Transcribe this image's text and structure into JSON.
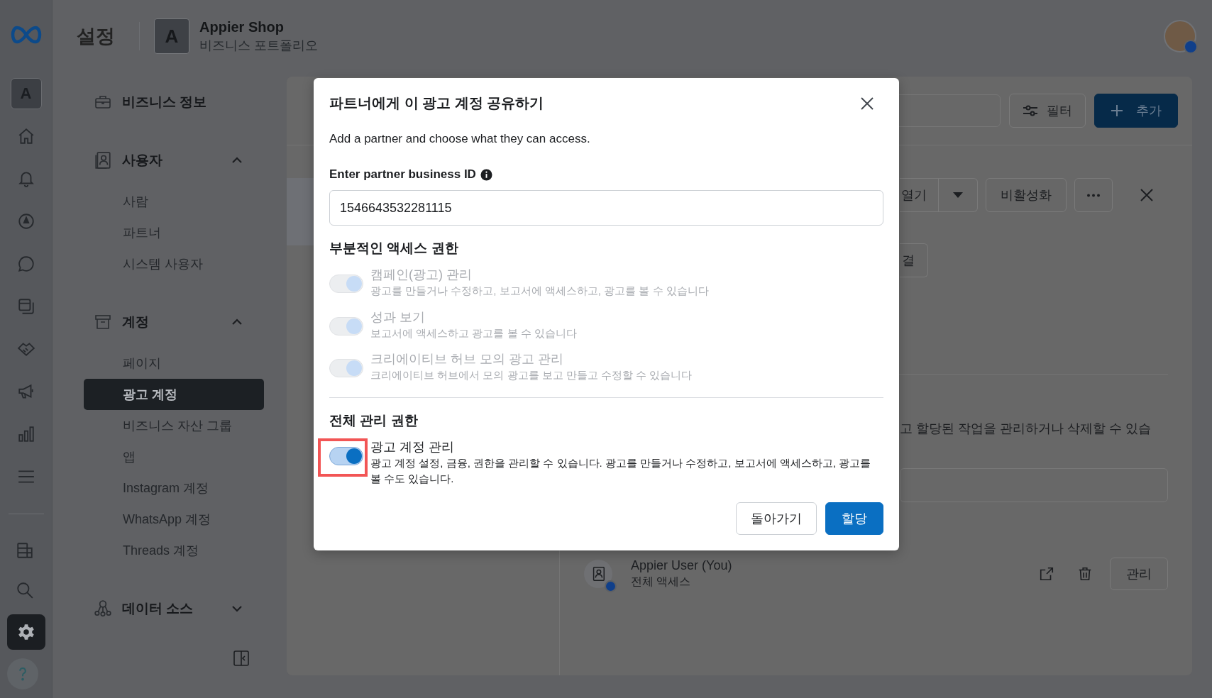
{
  "rail": {
    "avatar": "A",
    "top_items": [
      {
        "selected": false
      },
      {
        "selected": false
      },
      {
        "selected": false
      },
      {
        "selected": false
      },
      {
        "selected": false
      },
      {
        "selected": false
      },
      {
        "selected": false
      },
      {
        "selected": false
      },
      {
        "selected": false
      }
    ],
    "bottom_items": [
      {
        "selected": false
      },
      {
        "selected": false
      },
      {
        "selected": true
      },
      {
        "selected": false
      }
    ]
  },
  "header": {
    "title": "설정",
    "business": {
      "initial": "A",
      "name": "Appier Shop",
      "subtitle": "비즈니스 포트폴리오"
    }
  },
  "sidebar": {
    "groups": [
      {
        "kind": "link",
        "label": "비즈니스 정보"
      },
      {
        "kind": "section",
        "label": "사용자",
        "expanded": true,
        "children": [
          {
            "label": "사람",
            "selected": false
          },
          {
            "label": "파트너",
            "selected": false
          },
          {
            "label": "시스템 사용자",
            "selected": false
          }
        ]
      },
      {
        "kind": "section",
        "label": "계정",
        "expanded": true,
        "children": [
          {
            "label": "페이지",
            "selected": false
          },
          {
            "label": "광고 계정",
            "selected": true
          },
          {
            "label": "비즈니스 자산 그룹",
            "selected": false
          },
          {
            "label": "앱",
            "selected": false
          },
          {
            "label": "Instagram 계정",
            "selected": false
          },
          {
            "label": "WhatsApp 계정",
            "selected": false
          },
          {
            "label": "Threads 계정",
            "selected": false
          }
        ]
      },
      {
        "kind": "section",
        "label": "데이터 소스",
        "expanded": false
      }
    ]
  },
  "main": {
    "filter": "필터",
    "add": "추가"
  },
  "detail": {
    "open": "열기",
    "deactivate": "비활성화",
    "connect": "결",
    "note": "고 할당된 작업을 관리하거나 삭제할 수 있습",
    "user": {
      "name": "Appier User (You)",
      "access": "전체 액세스",
      "manage": "관리"
    }
  },
  "dialog": {
    "title": "파트너에게 이 광고 계정 공유하기",
    "subtitle": "Add a partner and choose what they can access.",
    "id_label": "Enter partner business ID",
    "id_value": "1546643532281115",
    "sections": [
      {
        "heading": "부분적인 액세스 권한",
        "permissions": [
          {
            "label": "캠페인(광고) 관리",
            "description": "광고를 만들거나 수정하고, 보고서에 액세스하고, 광고를 볼 수 있습니다",
            "on": true,
            "disabled": true,
            "highlighted": false
          },
          {
            "label": "성과 보기",
            "description": "보고서에 액세스하고 광고를 볼 수 있습니다",
            "on": true,
            "disabled": true,
            "highlighted": false
          },
          {
            "label": "크리에이티브 허브 모의 광고 관리",
            "description": "크리에이티브 허브에서 모의 광고를 보고 만들고 수정할 수 있습니다",
            "on": true,
            "disabled": true,
            "highlighted": false
          }
        ]
      },
      {
        "heading": "전체 관리 권한",
        "permissions": [
          {
            "label": "광고 계정 관리",
            "description": "광고 계정 설정, 금융, 권한을 관리할 수 있습니다. 광고를 만들거나 수정하고, 보고서에 액세스하고, 광고를 볼 수도 있습니다.",
            "on": true,
            "disabled": false,
            "highlighted": true
          }
        ]
      }
    ],
    "back": "돌아가기",
    "assign": "할당"
  }
}
